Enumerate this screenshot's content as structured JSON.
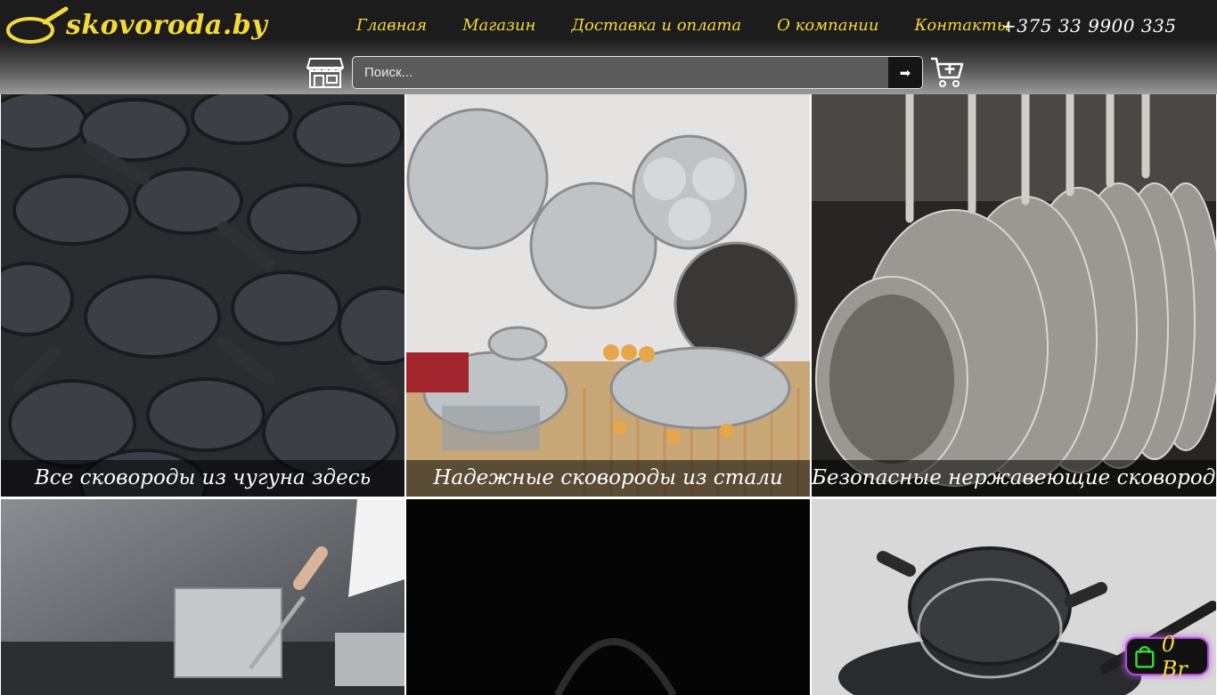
{
  "header": {
    "logo_text": "skovoroda.by",
    "nav": [
      {
        "label": "Главная"
      },
      {
        "label": "Магазин"
      },
      {
        "label": "Доставка и оплата"
      },
      {
        "label": "О компании"
      },
      {
        "label": "Контакты"
      }
    ],
    "phone": "+375 33 9900 335",
    "search": {
      "placeholder": "Поиск...",
      "button_label": "➡"
    },
    "icons": {
      "store": "store-icon",
      "cart": "cart-add-icon"
    }
  },
  "categories": [
    {
      "caption": "Все сковороды из чугуна здесь"
    },
    {
      "caption": "Надежные сковороды из стали"
    },
    {
      "caption": "Безопасные нержавеющие сковороды"
    },
    {
      "caption": ""
    },
    {
      "caption": ""
    },
    {
      "caption": ""
    }
  ],
  "cart_widget": {
    "total": "0 Br",
    "icon": "shopping-bag-icon"
  },
  "colors": {
    "accent": "#f4d93a",
    "header_dark": "#1c1c1c",
    "widget_glow": "#b04bd6",
    "bag_green": "#3fd23f"
  }
}
